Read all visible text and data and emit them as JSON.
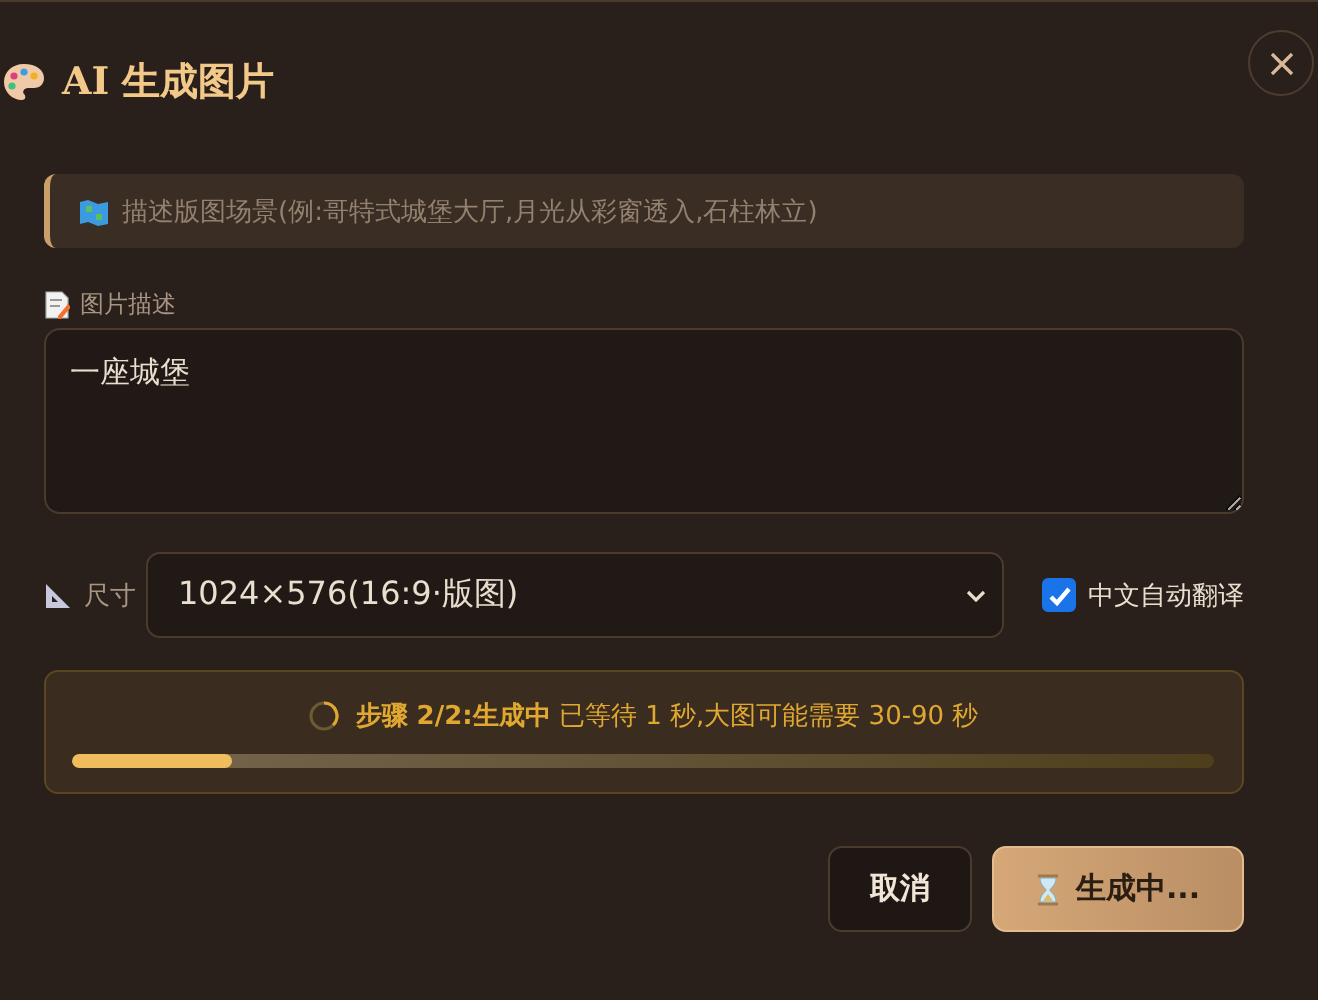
{
  "dialog": {
    "title": "AI 生成图片"
  },
  "hint": {
    "text": "描述版图场景(例:哥特式城堡大厅,月光从彩窗透入,石柱林立)"
  },
  "description": {
    "label": "图片描述",
    "value": "一座城堡"
  },
  "size": {
    "label": "尺寸",
    "value": "1024×576(16:9·版图)"
  },
  "translate": {
    "label": "中文自动翻译",
    "checked": true
  },
  "progress": {
    "status": "**步骤 2/2:生成中** 已等待 1 秒,大图可能需要 30-90 秒",
    "level": 0.14
  },
  "buttons": [
    {
      "label": "取消",
      "kind": "secondary"
    },
    {
      "label": "生成中...",
      "kind": "primary"
    }
  ]
}
